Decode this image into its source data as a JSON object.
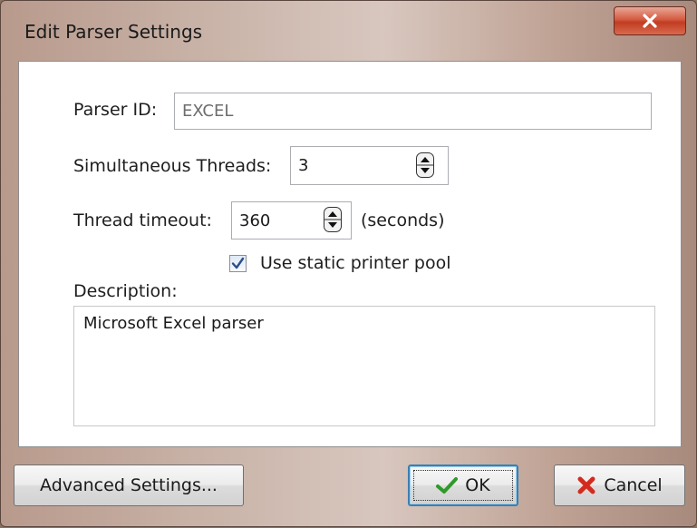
{
  "window": {
    "title": "Edit Parser Settings"
  },
  "form": {
    "parser_id_label": "Parser ID:",
    "parser_id_value": "EXCEL",
    "threads_label": "Simultaneous Threads:",
    "threads_value": "3",
    "timeout_label": "Thread timeout:",
    "timeout_value": "360",
    "timeout_unit": "(seconds)",
    "static_pool_label": "Use static printer pool",
    "static_pool_checked": true,
    "description_label": "Description:",
    "description_value": "Microsoft Excel parser"
  },
  "buttons": {
    "advanced": "Advanced Settings...",
    "ok": "OK",
    "cancel": "Cancel"
  },
  "icons": {
    "close": "close-icon",
    "ok": "checkmark-icon",
    "cancel": "red-x-icon",
    "spin": "spinner-icon"
  },
  "colors": {
    "close_button": "#c13c22",
    "ok_check": "#2f9a2a",
    "cancel_x": "#d42a1e",
    "focus_border": "#3c7fb1"
  }
}
